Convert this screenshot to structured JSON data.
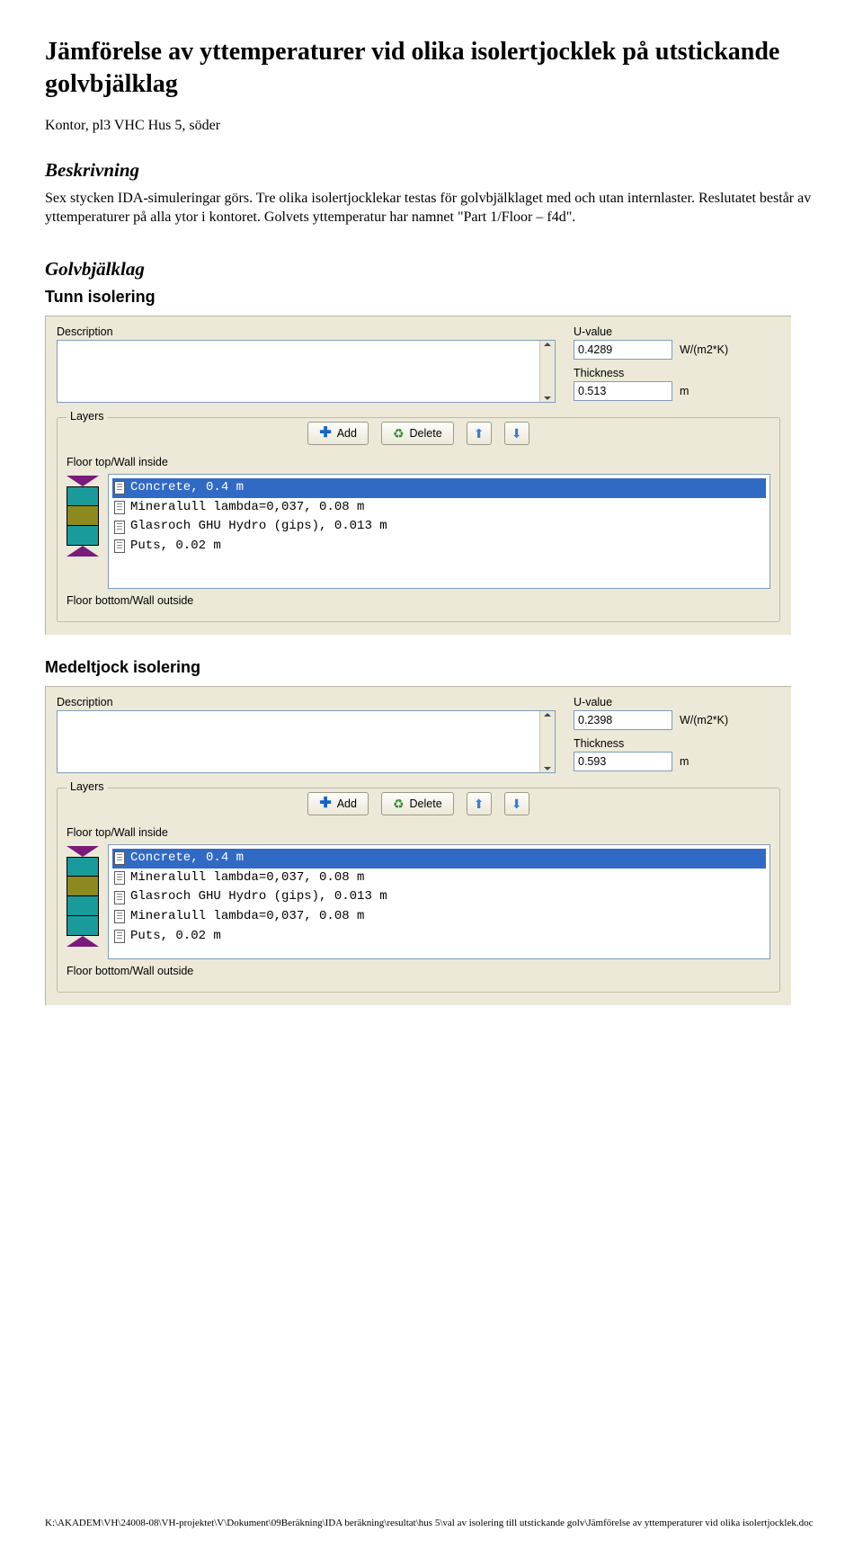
{
  "title": "Jämförelse av yttemperaturer vid olika isolertjocklek på utstickande golvbjälklag",
  "subtitle": "Kontor, pl3 VHC Hus 5, söder",
  "section_beskrivning": {
    "heading": "Beskrivning",
    "body": "Sex stycken IDA-simuleringar görs. Tre olika isolertjocklekar testas för golvbjälklaget med och utan internlaster. Reslutatet består av yttemperaturer på alla ytor i kontoret. Golvets yttemperatur har namnet \"Part 1/Floor – f4d\"."
  },
  "section_golvbjalklag": {
    "heading": "Golvbjälklag"
  },
  "panels": [
    {
      "heading": "Tunn isolering",
      "labels": {
        "description": "Description",
        "uvalue": "U-value",
        "thickness": "Thickness",
        "uvalue_unit": "W/(m2*K)",
        "thickness_unit": "m",
        "layers": "Layers",
        "floor_top": "Floor top/Wall inside",
        "floor_bottom": "Floor bottom/Wall outside",
        "add": "Add",
        "delete": "Delete"
      },
      "uvalue": "0.4289",
      "thickness": "0.513",
      "stack_colors": [
        "#1a9b9b",
        "#8c8a1f",
        "#1a9b9b"
      ],
      "items": [
        {
          "text": "Concrete, 0.4 m",
          "selected": true
        },
        {
          "text": "Mineralull lambda=0,037, 0.08 m",
          "selected": false
        },
        {
          "text": "Glasroch GHU Hydro (gips), 0.013 m",
          "selected": false
        },
        {
          "text": "Puts, 0.02 m",
          "selected": false
        }
      ]
    },
    {
      "heading": "Medeltjock isolering",
      "labels": {
        "description": "Description",
        "uvalue": "U-value",
        "thickness": "Thickness",
        "uvalue_unit": "W/(m2*K)",
        "thickness_unit": "m",
        "layers": "Layers",
        "floor_top": "Floor top/Wall inside",
        "floor_bottom": "Floor bottom/Wall outside",
        "add": "Add",
        "delete": "Delete"
      },
      "uvalue": "0.2398",
      "thickness": "0.593",
      "stack_colors": [
        "#1a9b9b",
        "#8c8a1f",
        "#1a9b9b",
        "#1a9b9b"
      ],
      "items": [
        {
          "text": "Concrete, 0.4 m",
          "selected": true
        },
        {
          "text": "Mineralull lambda=0,037, 0.08 m",
          "selected": false
        },
        {
          "text": "Glasroch GHU Hydro (gips), 0.013 m",
          "selected": false
        },
        {
          "text": "Mineralull lambda=0,037, 0.08 m",
          "selected": false
        },
        {
          "text": "Puts, 0.02 m",
          "selected": false
        }
      ]
    }
  ],
  "footer": "K:\\AKADEM\\VH\\24008-08\\VH-projektet\\V\\Dokument\\09Beräkning\\IDA beräkning\\resultat\\hus 5\\val av isolering till utstickande golv\\Jämförelse av yttemperaturer vid olika isolertjocklek.doc"
}
